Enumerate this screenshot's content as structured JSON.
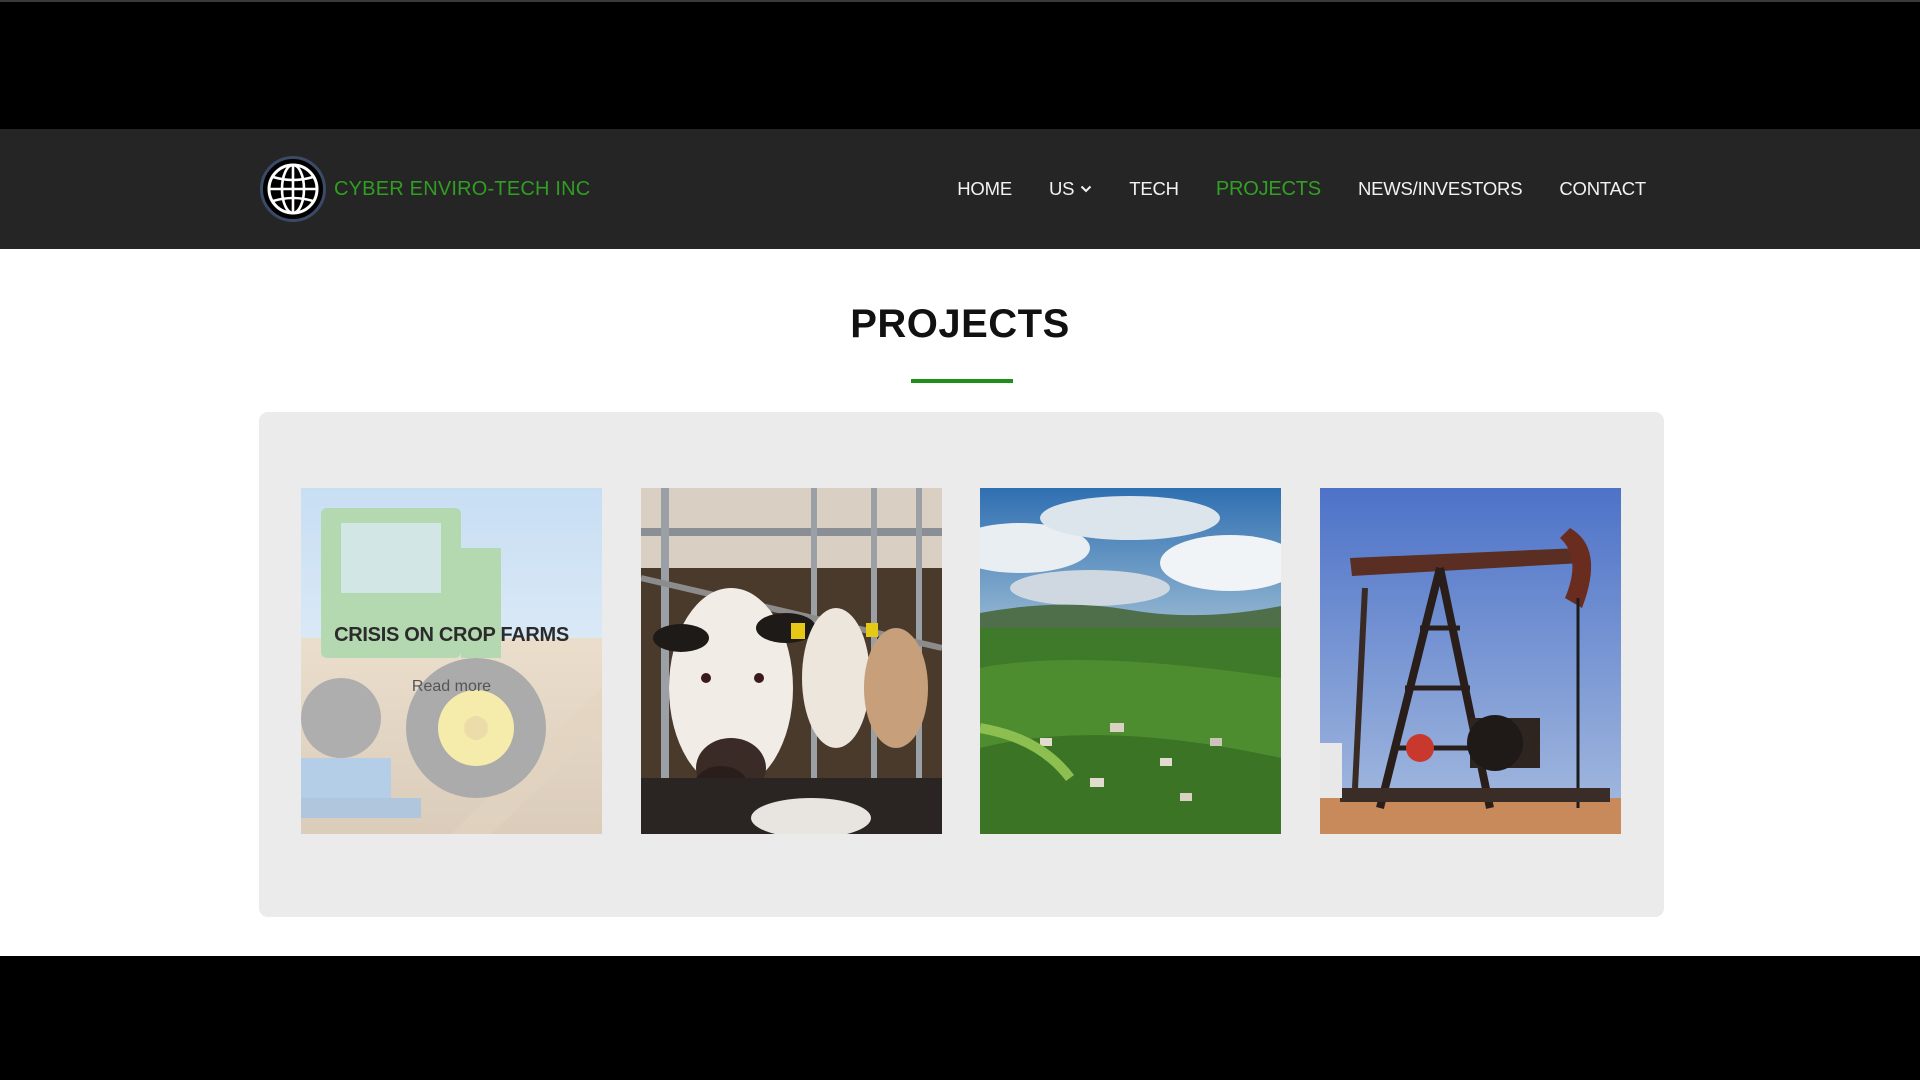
{
  "brand": {
    "name": "CYBER ENVIRO-TECH INC"
  },
  "nav": {
    "items": [
      {
        "label": "HOME",
        "active": false
      },
      {
        "label": "US",
        "active": false,
        "dropdown": true
      },
      {
        "label": "TECH",
        "active": false
      },
      {
        "label": "PROJECTS",
        "active": true
      },
      {
        "label": "NEWS/INVESTORS",
        "active": false
      },
      {
        "label": "CONTACT",
        "active": false
      }
    ]
  },
  "main": {
    "title": "PROJECTS",
    "cards": [
      {
        "title": "CRISIS ON CROP FARMS",
        "link": "Read more",
        "image": "tractor-field"
      },
      {
        "image": "dairy-cows"
      },
      {
        "image": "green-hills-town"
      },
      {
        "image": "oil-pumpjack"
      }
    ]
  },
  "colors": {
    "accent": "#2f9e22",
    "navbar": "#252525",
    "panel": "#ebebeb"
  }
}
